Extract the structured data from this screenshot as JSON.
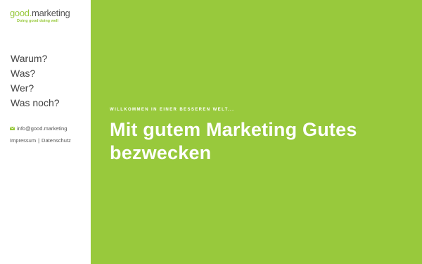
{
  "brand": {
    "logo_good": "good",
    "logo_dot": ".",
    "logo_marketing": "marketing",
    "tagline": "Doing good doing well",
    "accent_color": "#98c93c"
  },
  "nav": {
    "items": [
      "Warum?",
      "Was?",
      "Wer?",
      "Was noch?"
    ]
  },
  "contact": {
    "email": "info@good.marketing",
    "email_icon": "mail-icon",
    "impressum": "Impressum",
    "separator": "|",
    "datenschutz": "Datenschutz"
  },
  "hero": {
    "kicker": "WILLKOMMEN IN EINER BESSEREN WELT...",
    "title": "Mit gutem Marketing Gutes bezwecken",
    "background": "#98c93c"
  }
}
